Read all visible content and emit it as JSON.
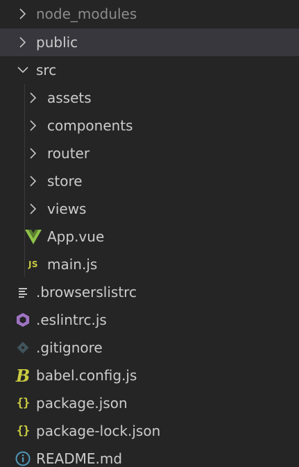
{
  "explorer": {
    "items": [
      {
        "label": "node_modules",
        "icon": "chevron-right-icon"
      },
      {
        "label": "public",
        "icon": "chevron-right-icon"
      },
      {
        "label": "src",
        "icon": "chevron-down-icon"
      },
      {
        "label": "assets",
        "icon": "chevron-right-icon"
      },
      {
        "label": "components",
        "icon": "chevron-right-icon"
      },
      {
        "label": "router",
        "icon": "chevron-right-icon"
      },
      {
        "label": "store",
        "icon": "chevron-right-icon"
      },
      {
        "label": "views",
        "icon": "chevron-right-icon"
      },
      {
        "label": "App.vue",
        "icon": "vue-icon"
      },
      {
        "label": "main.js",
        "icon": "js-icon",
        "badge": "JS"
      },
      {
        "label": ".browserslistrc",
        "icon": "list-lines-icon"
      },
      {
        "label": ".eslintrc.js",
        "icon": "eslint-icon"
      },
      {
        "label": ".gitignore",
        "icon": "git-icon"
      },
      {
        "label": "babel.config.js",
        "icon": "babel-icon",
        "badge": "B"
      },
      {
        "label": "package.json",
        "icon": "json-icon",
        "badge": "{}"
      },
      {
        "label": "package-lock.json",
        "icon": "json-icon",
        "badge": "{}"
      },
      {
        "label": "README.md",
        "icon": "info-icon"
      }
    ]
  },
  "colors": {
    "background": "#252526",
    "selected_row": "#37373d",
    "text": "#cccccc",
    "dimmed_text": "#8c8c8c",
    "vue_green": "#8dc149",
    "yellow_accent": "#cbcb41",
    "eslint_purple": "#a074c4",
    "git_gray": "#41535b",
    "info_blue": "#519aba"
  }
}
